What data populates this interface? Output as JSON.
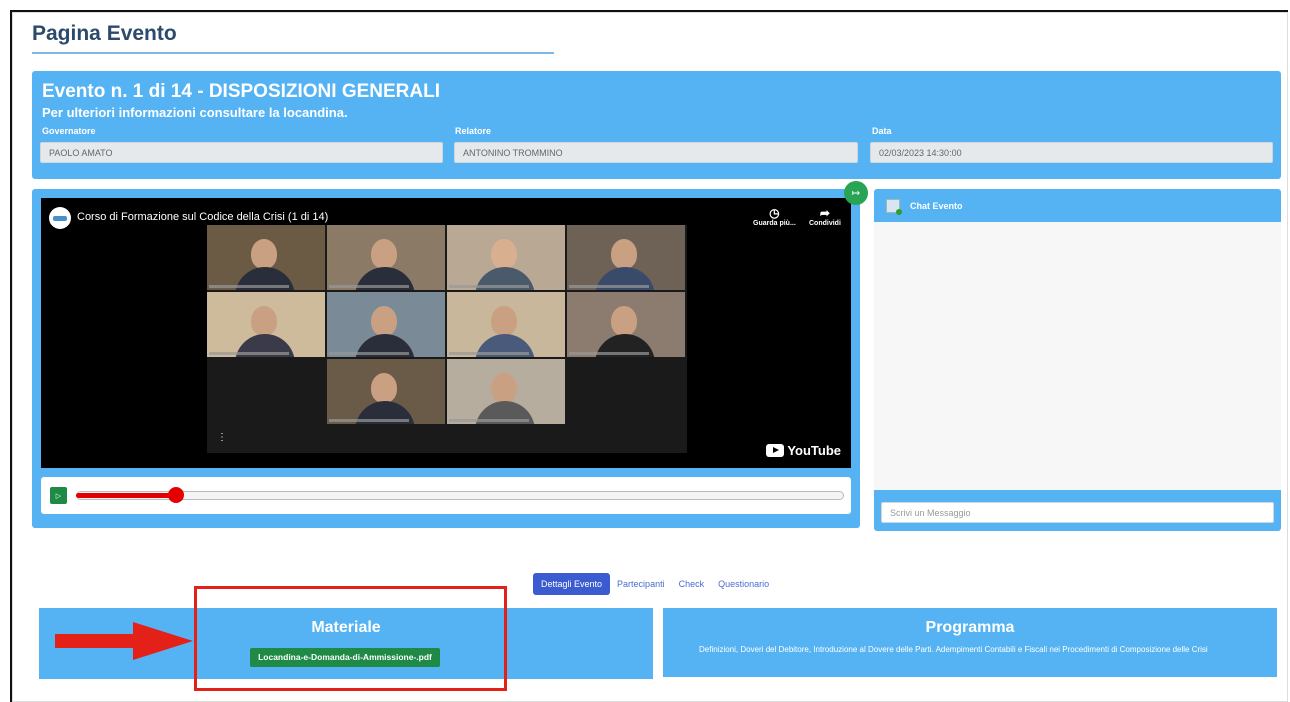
{
  "page": {
    "title": "Pagina Evento"
  },
  "event": {
    "title": "Evento n. 1 di 14 - DISPOSIZIONI GENERALI",
    "subtitle": "Per ulteriori informazioni consultare la locandina.",
    "fields": [
      {
        "label": "Governatore",
        "value": "PAOLO AMATO"
      },
      {
        "label": "Relatore",
        "value": "ANTONINO TROMMINO"
      },
      {
        "label": "Data",
        "value": "02/03/2023 14:30:00"
      }
    ]
  },
  "video": {
    "title": "Corso di Formazione sul Codice della Crisi (1 di 14)",
    "watch_later": "Guarda più...",
    "share": "Condividi",
    "brand": "YouTube",
    "progress_fraction": 0.13
  },
  "chat": {
    "title": "Chat Evento",
    "placeholder": "Scrivi un Messaggio"
  },
  "tabs": [
    {
      "label": "Dettagli Evento",
      "active": true
    },
    {
      "label": "Partecipanti",
      "active": false
    },
    {
      "label": "Check",
      "active": false
    },
    {
      "label": "Questionario",
      "active": false
    }
  ],
  "materiale": {
    "title": "Materiale",
    "file": "Locandina-e-Domanda-di-Ammissione-.pdf"
  },
  "programma": {
    "title": "Programma",
    "text": "Definizioni, Doveri del Debitore, Introduzione al Dovere delle Parti. Adempimenti Contabili e Fiscali nei Procedimenti di Composizione delle Crisi"
  },
  "colors": {
    "panel": "#55b3f3",
    "accent": "#1e8a46",
    "highlight": "#e32119",
    "progress": "#e40000"
  }
}
